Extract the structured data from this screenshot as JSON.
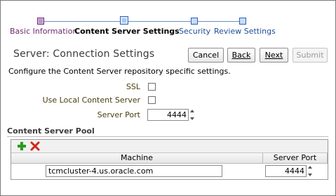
{
  "train": {
    "steps": [
      {
        "label": "Basic Information",
        "state": "visited"
      },
      {
        "label": "Content Server Settings",
        "state": "current"
      },
      {
        "label": "Security",
        "state": "next"
      },
      {
        "label": "Review Settings",
        "state": "next"
      }
    ]
  },
  "header": {
    "title": "Server: Connection Settings",
    "buttons": {
      "cancel": "Cancel",
      "back": "Back",
      "next": "Next",
      "submit": "Submit"
    }
  },
  "instructions": "Configure the Content Server repository specific settings.",
  "form": {
    "ssl_label": "SSL",
    "ssl_checked": false,
    "local_label": "Use Local Content Server",
    "local_checked": false,
    "port_label": "Server Port",
    "port_value": "4444"
  },
  "pool": {
    "title": "Content Server Pool",
    "columns": [
      "Machine",
      "Server Port"
    ],
    "rows": [
      {
        "machine": "tcmcluster-4.us.oracle.com",
        "port": "4444"
      }
    ],
    "icons": {
      "add": "add-icon",
      "delete": "delete-icon"
    }
  },
  "colors": {
    "visited": "#6d2b6d",
    "current_step_border": "#2f63b6",
    "link": "#1f4e96",
    "label": "#4a3d0b",
    "add_icon": "#2e9a1f",
    "delete_icon": "#d2281b"
  }
}
